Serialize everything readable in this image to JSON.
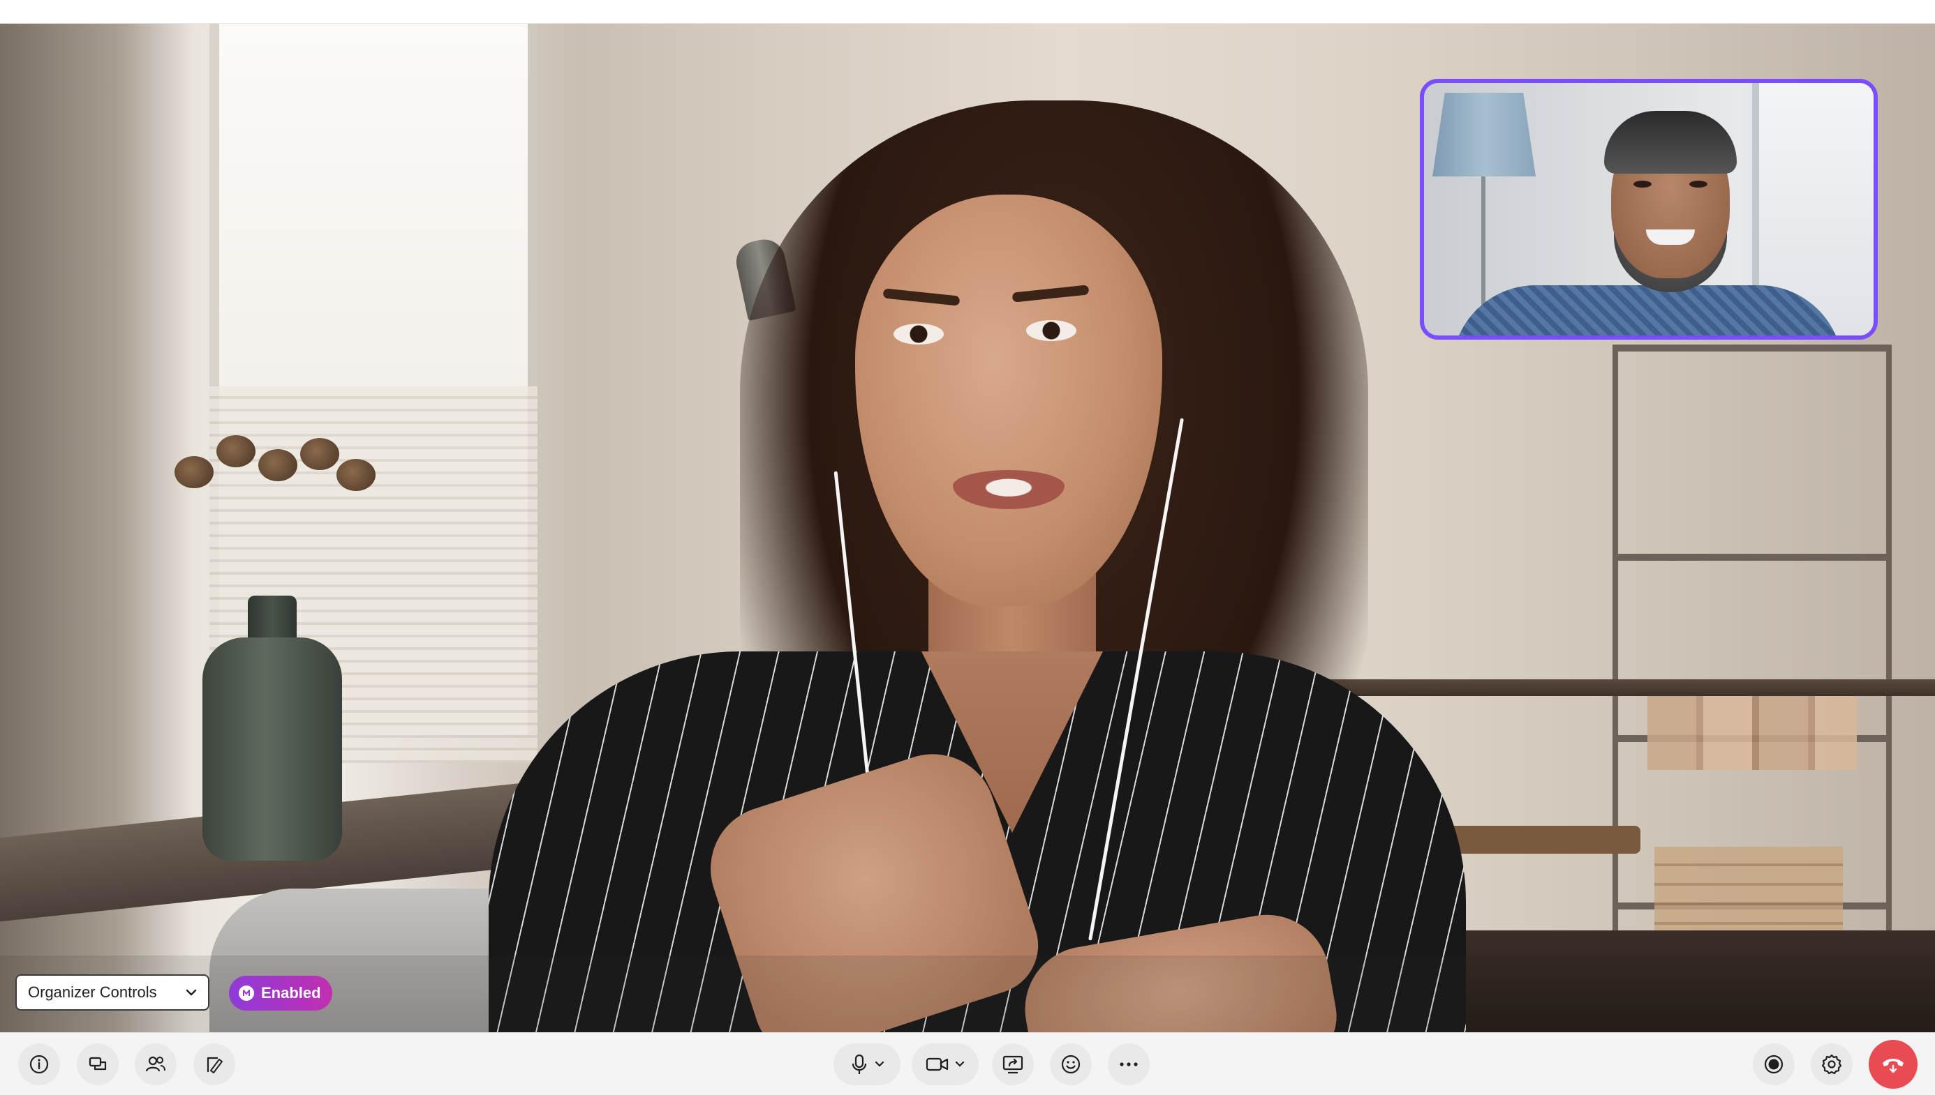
{
  "organizer": {
    "select_label": "Organizer Controls",
    "status_label": "Enabled"
  },
  "participants": {
    "main_speaker": "presenter-video",
    "pip_speaker": "self-view-video"
  },
  "toolbar": {
    "left": [
      "info-icon",
      "chat-icon",
      "participants-icon",
      "whiteboard-icon"
    ],
    "center": [
      "microphone-icon",
      "camera-icon",
      "share-screen-icon",
      "reactions-icon",
      "more-icon"
    ],
    "right": [
      "record-icon",
      "settings-icon",
      "end-call-icon"
    ]
  },
  "colors": {
    "pip_border": "#7a4dff",
    "enabled_gradient_start": "#8e3bd9",
    "enabled_gradient_end": "#c12fb0",
    "end_call": "#ea4b53",
    "toolbar_bg": "#f4f4f4"
  }
}
